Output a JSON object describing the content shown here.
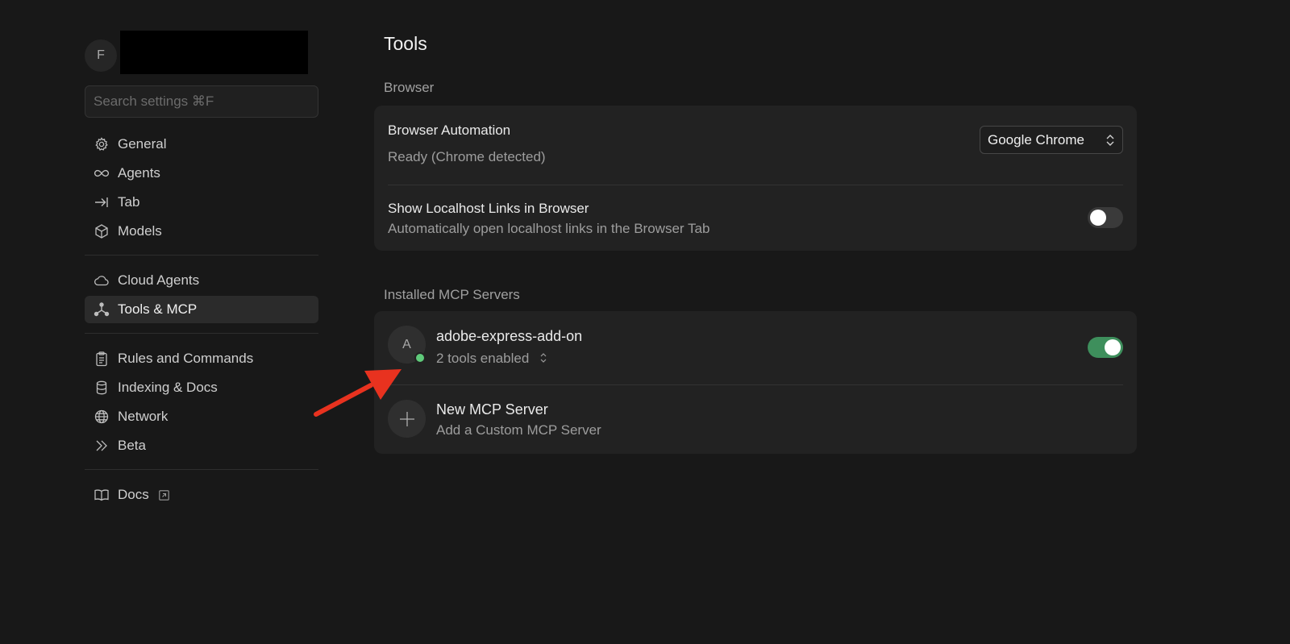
{
  "profile": {
    "initial": "F"
  },
  "search": {
    "placeholder": "Search settings ⌘F"
  },
  "sidebar": {
    "group1": [
      {
        "label": "General",
        "icon": "gear-icon"
      },
      {
        "label": "Agents",
        "icon": "infinity-icon"
      },
      {
        "label": "Tab",
        "icon": "tab-arrow-icon"
      },
      {
        "label": "Models",
        "icon": "cube-icon"
      }
    ],
    "group2": [
      {
        "label": "Cloud Agents",
        "icon": "cloud-icon"
      },
      {
        "label": "Tools & MCP",
        "icon": "tools-nodes-icon",
        "active": true
      }
    ],
    "group3": [
      {
        "label": "Rules and Commands",
        "icon": "clipboard-icon"
      },
      {
        "label": "Indexing & Docs",
        "icon": "database-icon"
      },
      {
        "label": "Network",
        "icon": "globe-icon"
      },
      {
        "label": "Beta",
        "icon": "double-chevron-icon"
      }
    ],
    "group4": [
      {
        "label": "Docs",
        "icon": "book-icon"
      }
    ]
  },
  "main": {
    "title": "Tools",
    "browser_section": {
      "label": "Browser",
      "automation": {
        "title": "Browser Automation",
        "status": "Ready (Chrome detected)",
        "selected_browser": "Google Chrome"
      },
      "localhost": {
        "title": "Show Localhost Links in Browser",
        "description": "Automatically open localhost links in the Browser Tab",
        "enabled": false
      }
    },
    "mcp_section": {
      "label": "Installed MCP Servers",
      "servers": [
        {
          "initial": "A",
          "name": "adobe-express-add-on",
          "tools": "2 tools enabled",
          "enabled": true,
          "status_color": "#5fca7a"
        }
      ],
      "new_server": {
        "title": "New MCP Server",
        "description": "Add a Custom MCP Server"
      }
    }
  },
  "colors": {
    "background": "#181818",
    "card": "#222222",
    "toggle_on": "#3e8f5c",
    "annotation_arrow": "#e8321f"
  }
}
